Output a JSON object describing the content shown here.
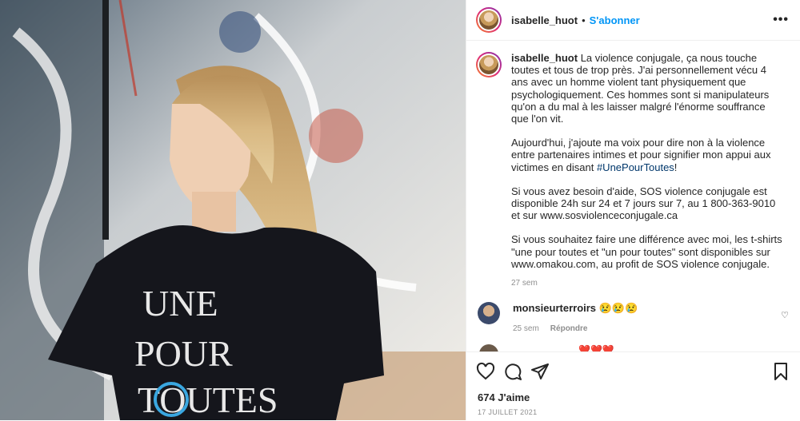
{
  "post": {
    "username": "isabelle_huot",
    "separator": "•",
    "follow_label": "S'abonner",
    "more_icon": "more-horizontal-icon",
    "shirt_text": [
      "UNE",
      "POUR",
      "TOUTES"
    ]
  },
  "caption": {
    "username": "isabelle_huot",
    "p1": "La violence conjugale, ça nous touche toutes et tous de trop près. J'ai personnellement vécu 4 ans avec un homme violent tant physiquement que psychologiquement. Ces hommes sont si manipulateurs qu'on a du mal à les laisser malgré l'énorme souffrance que l'on vit.",
    "p2_before": "Aujourd'hui, j'ajoute ma voix pour dire non à la violence entre partenaires intimes et pour signifier mon appui aux victimes en disant",
    "hashtag": "#UnePourToutes",
    "p2_after": "!",
    "p3": "Si vous avez besoin d'aide, SOS violence conjugale est disponible 24h sur 24 et 7 jours sur 7, au 1 800-363-9010 et sur www.sosviolenceconjugale.ca",
    "p4": "Si vous souhaitez faire une différence avec moi, les t-shirts \"une pour toutes et \"un pour toutes\" sont disponibles sur www.omakou.com, au profit de SOS violence conjugale.",
    "time": "27 sem"
  },
  "comments": [
    {
      "username": "monsieurterroirs",
      "text": "😢😢😢",
      "time": "25 sem",
      "reply_label": "Répondre"
    }
  ],
  "partial_comment_emoji": "❤️❤️❤️",
  "actions": {
    "likes": "674 J'aime",
    "date": "17 JUILLET 2021"
  },
  "colors": {
    "link": "#0095f6",
    "hashtag": "#00376b",
    "muted": "#8e8e8e"
  }
}
